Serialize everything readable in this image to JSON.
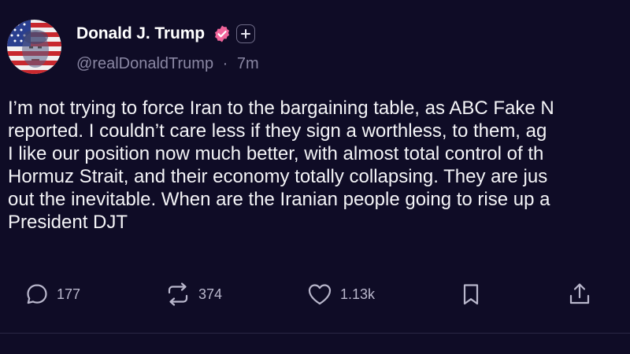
{
  "post": {
    "author": {
      "display_name": "Donald J. Trump",
      "handle": "@realDonaldTrump",
      "separator": "·",
      "time_ago": "7m",
      "verified_icon": "verified-badge-icon",
      "verified_color": "#f0649a",
      "subscribe_icon": "plus-icon"
    },
    "text_lines": [
      "I’m not trying to force Iran to the bargaining table, as ABC Fake N",
      "reported. I couldn’t care less if they sign a worthless, to them, ag",
      "I like our position now much better, with almost total control of th",
      "Hormuz Strait, and their economy totally collapsing. They are jus",
      "out the inevitable. When are the Iranian people going to rise up a",
      "President DJT"
    ],
    "actions": {
      "reply": {
        "icon": "comment-icon",
        "count": "177"
      },
      "repost": {
        "icon": "repost-icon",
        "count": "374"
      },
      "like": {
        "icon": "heart-icon",
        "count": "1.13k"
      },
      "bookmark": {
        "icon": "bookmark-icon"
      },
      "share": {
        "icon": "share-icon"
      }
    }
  },
  "colors": {
    "background": "#0f0c26",
    "text": "#f4f4f7",
    "muted": "#8a87a3",
    "action": "#b9b7cc"
  }
}
